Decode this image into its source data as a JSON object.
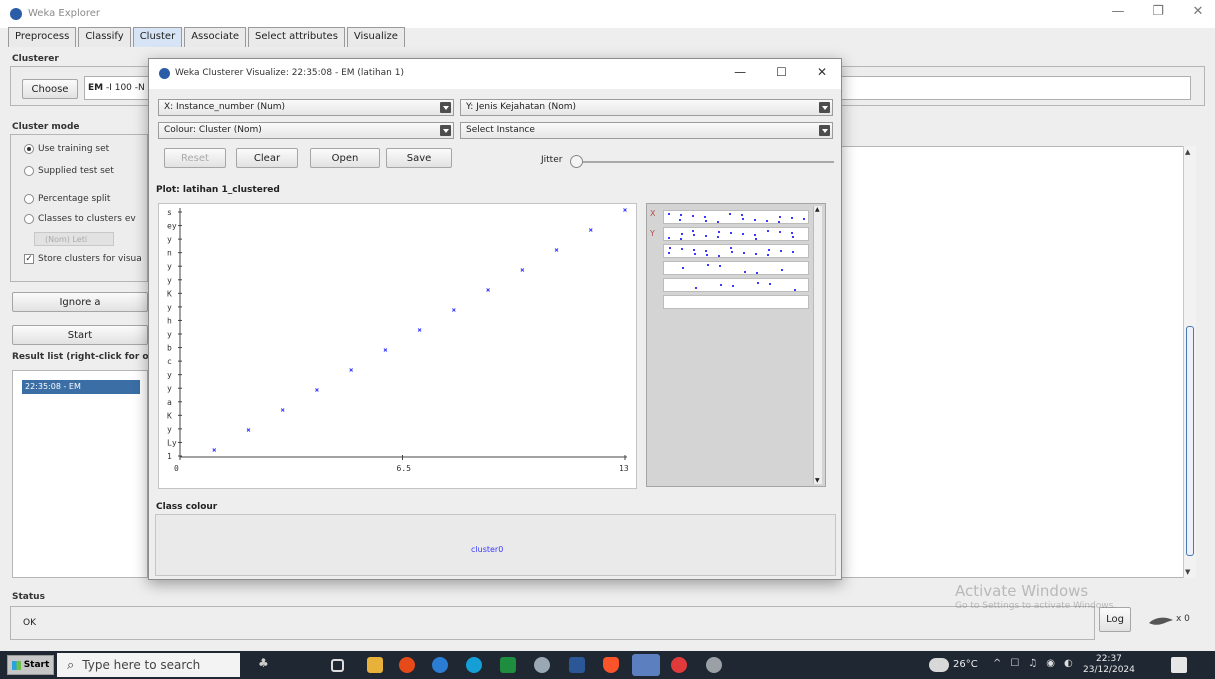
{
  "window": {
    "title": "Weka Explorer"
  },
  "tabs": [
    "Preprocess",
    "Classify",
    "Cluster",
    "Associate",
    "Select attributes",
    "Visualize"
  ],
  "active_tab": "Cluster",
  "clusterer": {
    "label": "Clusterer",
    "choose_label": "Choose",
    "value_prefix": "EM",
    "value_rest": " -I 100 -N"
  },
  "cluster_mode": {
    "label": "Cluster mode",
    "options": [
      "Use training set",
      "Supplied test set",
      "Percentage split",
      "Classes to clusters ev"
    ],
    "selected": "Use training set",
    "nom_class": "(Nom) Leti",
    "store_label": "Store clusters for visua"
  },
  "ignore_label": "Ignore a",
  "start_label": "Start",
  "result_list": {
    "label": "Result list (right-click for op",
    "items": [
      "22:35:08 - EM"
    ]
  },
  "status": {
    "label": "Status",
    "text": "OK",
    "log_label": "Log",
    "x_count": "x 0"
  },
  "watermark": {
    "line1": "Activate Windows",
    "line2": "Go to Settings to activate Windows."
  },
  "dialog": {
    "title": "Weka Clusterer Visualize: 22:35:08 - EM (latihan 1)",
    "x_combo": "X: Instance_number (Num)",
    "y_combo": "Y: Jenis Kejahatan (Nom)",
    "colour_combo": "Colour: Cluster (Nom)",
    "select_combo": "Select Instance",
    "reset_label": "Reset",
    "clear_label": "Clear",
    "open_label": "Open",
    "save_label": "Save",
    "jitter_label": "Jitter",
    "plot_title": "Plot: latihan 1_clustered",
    "class_colour_label": "Class colour",
    "cluster_legend": "cluster0",
    "side_labels": [
      "X",
      "Y"
    ]
  },
  "chart_data": {
    "type": "scatter",
    "title": "Plot: latihan 1_clustered",
    "x_ticks": [
      "0",
      "6.5",
      "13"
    ],
    "xlim": [
      0,
      13
    ],
    "y_tick_labels": [
      "s",
      "ey",
      "y",
      "n",
      "y",
      "y",
      "K",
      "y",
      "h",
      "y",
      "b",
      "c",
      "y",
      "y",
      "a",
      "K",
      "y",
      "Ly",
      "1"
    ],
    "x": [
      1,
      2,
      3,
      4,
      5,
      6,
      7,
      8,
      9,
      10,
      11,
      12,
      13
    ],
    "y": [
      1,
      2,
      3,
      4,
      5,
      6,
      7,
      8,
      9,
      10,
      11,
      12,
      13
    ],
    "series": [
      {
        "name": "cluster0"
      }
    ],
    "color": "#3a3aff"
  },
  "taskbar": {
    "start_label": "Start",
    "search_placeholder": "Type here to search",
    "weather": "26°C",
    "time": "22:37",
    "date": "23/12/2024"
  }
}
